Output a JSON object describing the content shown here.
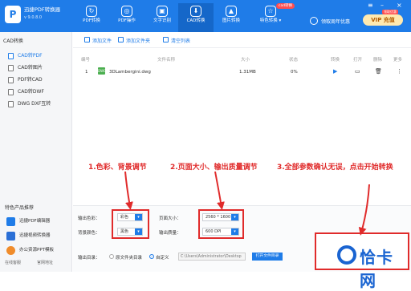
{
  "app": {
    "name": "迅捷PDF转换器",
    "version": "v 9.0.8.0"
  },
  "topnav": [
    {
      "label": "PDF转换",
      "icon": "convert-icon"
    },
    {
      "label": "PDF操作",
      "icon": "tools-icon"
    },
    {
      "label": "文字识别",
      "icon": "ocr-icon"
    },
    {
      "label": "CAD转换",
      "icon": "cad-icon"
    },
    {
      "label": "图片转换",
      "icon": "image-icon"
    },
    {
      "label": "特色转换 ▾",
      "icon": "special-icon"
    }
  ],
  "hot_badge": "cad转换",
  "promo": "领取周年优惠",
  "vip": {
    "label": "VIP 充值"
  },
  "win_badge": "领取优惠",
  "sidebar": {
    "header": "CAD转换",
    "items": [
      "CAD转PDF",
      "CAD转图片",
      "PDF转CAD",
      "CAD转DWF",
      "DWG DXF互转"
    ],
    "featured_header": "特色产品推荐",
    "featured": [
      "迅捷PDF编辑器",
      "迅捷视频转换器",
      "办公资源PPT模板"
    ],
    "bottom": [
      "在线客服",
      "官网地址"
    ]
  },
  "toolbar": {
    "add_file": "添加文件",
    "add_folder": "添加文件夹",
    "clear": "清空列表"
  },
  "columns": [
    "编号",
    "文件名称",
    "大小",
    "状态",
    "转换",
    "打开",
    "删除",
    "更多"
  ],
  "rows": [
    {
      "index": "1",
      "name": "3DLambergini.dwg",
      "size": "1.31MB",
      "status": "0%",
      "badge": "DWG"
    }
  ],
  "options": {
    "output_color_label": "输出色彩：",
    "output_color": "彩色",
    "bg_color_label": "背景颜色：",
    "bg_color": "黑色",
    "page_size_label": "页面大小：",
    "page_size": "2560 * 1600",
    "quality_label": "输出质量：",
    "quality": "600 DPI",
    "output_dir_label": "输出目录：",
    "radio_original": "原文件夹目录",
    "radio_custom": "自定义",
    "path": "C:\\Users\\Administrator\\Desktop",
    "open_folder": "打开文件目录"
  },
  "annotations": {
    "a1": "1.色彩、背景调节",
    "a2": "2.页面大小、输出质量调节",
    "a3": "3.全部参数确认无误，点击开始转换"
  },
  "watermark": {
    "text": "恰卡网"
  },
  "colors": {
    "brand": "#1f7ce8",
    "annotation": "#e02b2b"
  }
}
